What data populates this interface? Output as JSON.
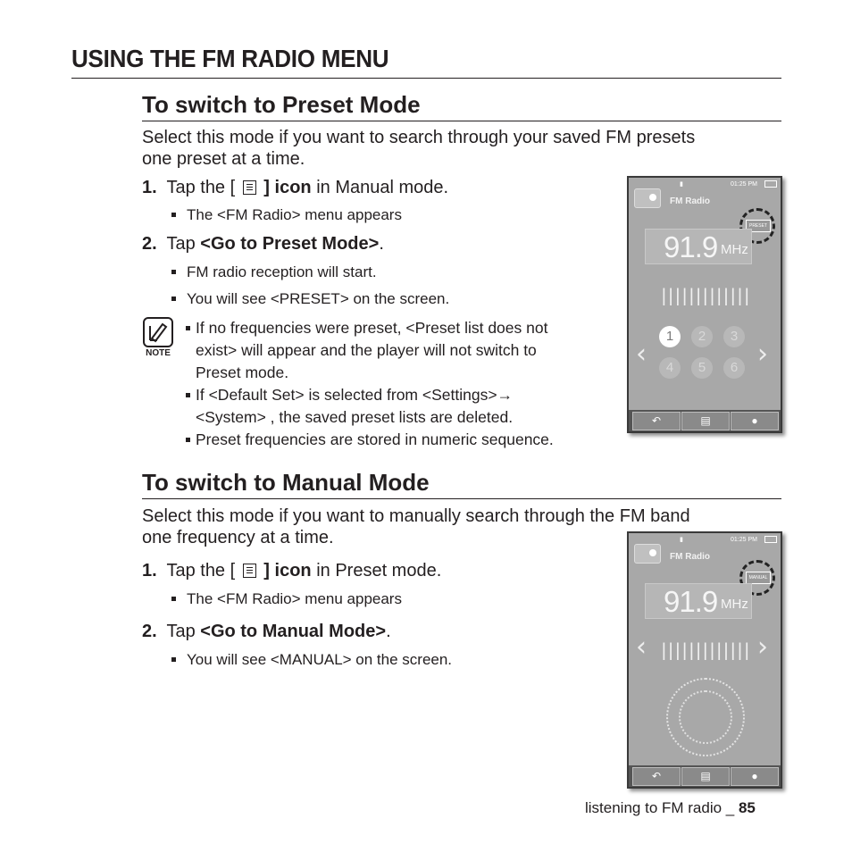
{
  "page": {
    "title": "USING THE FM RADIO MENU",
    "footer_text": "listening to FM radio _ ",
    "footer_page": "85"
  },
  "preset_section": {
    "heading": "To switch to Preset Mode",
    "intro_line1": "Select this mode if you want to search through your saved FM presets",
    "intro_line2": "one preset at a time.",
    "step1_num": "1.",
    "step1_pre": "Tap the [",
    "step1_bold": "] icon",
    "step1_post": " in Manual mode.",
    "step1_bullet": "The <FM Radio> menu appears",
    "step2_num": "2.",
    "step2_pre": "Tap ",
    "step2_bold": "<Go to Preset Mode>",
    "step2_post": ".",
    "step2_bullet1": "FM radio reception will start.",
    "step2_bullet2": "You will see <PRESET> on the screen.",
    "note_label": "NOTE",
    "note1_line1": "If no frequencies were preset, <Preset list does not",
    "note1_line2": "exist> will appear and the player will not switch to",
    "note1_line3": "Preset mode.",
    "note2_line1": "If <Default Set> is selected from <Settings>→",
    "note2_line2": "<System> , the saved preset lists are deleted.",
    "note3_line1": "Preset frequencies are stored in numeric sequence."
  },
  "manual_section": {
    "heading": "To switch to Manual Mode",
    "intro_line1": "Select this mode if you want to manually search through the FM band",
    "intro_line2": "one frequency at a time.",
    "step1_num": "1.",
    "step1_pre": "Tap the [",
    "step1_bold": "] icon",
    "step1_post": " in Preset mode.",
    "step1_bullet": "The <FM Radio> menu appears",
    "step2_num": "2.",
    "step2_pre": "Tap ",
    "step2_bold": "<Go to Manual Mode>",
    "step2_post": ".",
    "step2_bullet1": "You will see <MANUAL> on the screen."
  },
  "device_preset": {
    "time": "01:25 PM",
    "title": "FM Radio",
    "badge": "PRESET",
    "frequency": "91.9",
    "unit": "MHz",
    "presets": [
      "1",
      "2",
      "3",
      "4",
      "5",
      "6"
    ],
    "selected_preset": "1",
    "tuner_marks": "|||||||||||||||||"
  },
  "device_manual": {
    "time": "01:25 PM",
    "title": "FM Radio",
    "badge": "MANUAL",
    "frequency": "91.9",
    "unit": "MHz",
    "tuner_marks": "|||||||||||||||||"
  },
  "icons": {
    "back": "back-arrow-icon",
    "menu": "menu-list-icon",
    "record": "dot-icon"
  }
}
